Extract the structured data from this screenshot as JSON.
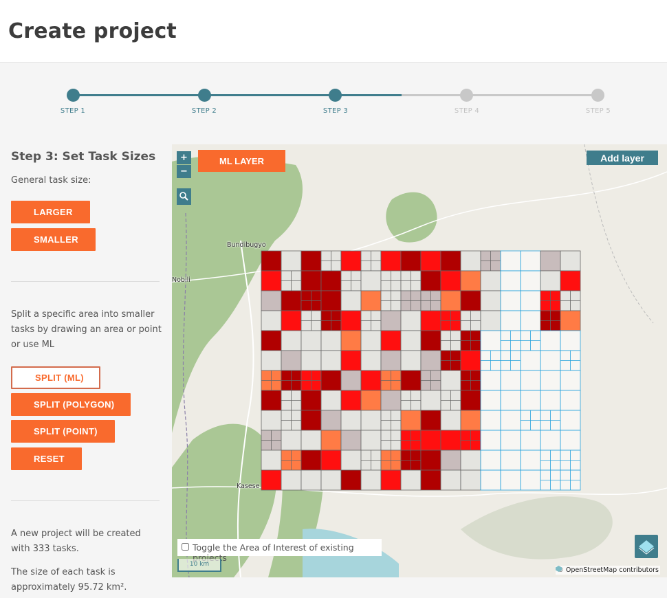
{
  "header": {
    "title": "Create project"
  },
  "stepper": {
    "steps": [
      {
        "label": "STEP 1",
        "active": true
      },
      {
        "label": "STEP 2",
        "active": true
      },
      {
        "label": "STEP 3",
        "active": true
      },
      {
        "label": "STEP 4",
        "active": false
      },
      {
        "label": "STEP 5",
        "active": false
      }
    ],
    "colors": {
      "active": "#3f7d8c",
      "inactive": "#c8c8c8"
    }
  },
  "panel": {
    "heading": "Step 3: Set Task Sizes",
    "general_label": "General task size:",
    "larger_label": "LARGER",
    "smaller_label": "SMALLER",
    "split_description": "Split a specific area into smaller tasks by drawing an area or point or use ML",
    "split_ml_label": "SPLIT (ML)",
    "split_polygon_label": "SPLIT (POLYGON)",
    "split_point_label": "SPLIT (POINT)",
    "reset_label": "RESET",
    "summary_line": "A new project will be created with 333 tasks.",
    "size_line": "The size of each task is approximately 95.72 km²."
  },
  "map": {
    "zoom_in": "+",
    "zoom_out": "−",
    "ml_layer_label": "ML LAYER",
    "add_layer_label": "Add layer",
    "toggle_label": "Toggle the Area of Interest of existing projects",
    "toggle_checked": false,
    "scale_label": "10 km",
    "attribution_prefix": "© ",
    "attribution_osm": "OpenStreetMap",
    "attribution_suffix": " contributors",
    "places": [
      "Bundibugyo",
      "Nobili",
      "Kasese"
    ],
    "icons": {
      "search": "search-icon",
      "layers": "layers-icon",
      "osm": "osm-logo-icon"
    },
    "colors": {
      "accent": "#f96a2d",
      "dark_red": "#b00000",
      "red": "#ff0f0f",
      "orange": "#ff7b45",
      "grey_task": "#c8bcbc",
      "light_task": "#e4e4e0",
      "blue_grid": "#27a3dc",
      "park_green": "#aac795",
      "water": "#a7d5dc"
    }
  }
}
